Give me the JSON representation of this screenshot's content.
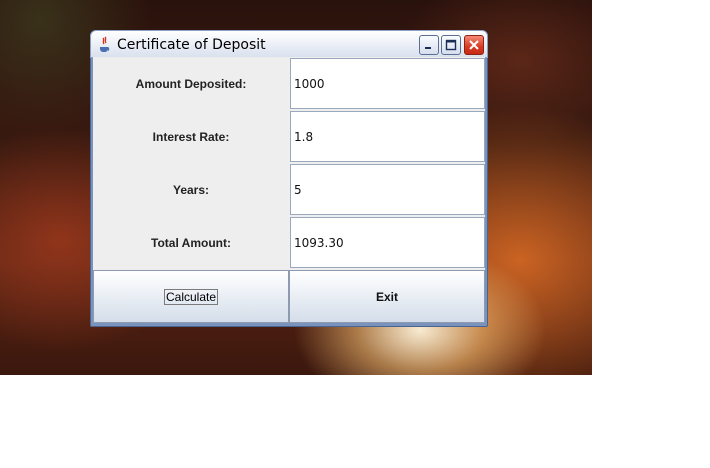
{
  "window": {
    "title": "Certificate of Deposit"
  },
  "form": {
    "rows": [
      {
        "label": "Amount Deposited:",
        "value": "1000"
      },
      {
        "label": "Interest Rate:",
        "value": "1.8"
      },
      {
        "label": "Years:",
        "value": "5"
      },
      {
        "label": "Total Amount:",
        "value": "1093.30"
      }
    ]
  },
  "buttons": {
    "calculate": "Calculate",
    "exit": "Exit"
  },
  "icons": {
    "app": "java-cup-icon",
    "minimize": "minimize-icon",
    "maximize": "maximize-icon",
    "close": "close-icon"
  },
  "colors": {
    "close_button": "#d83a22",
    "titlebar": "#eef2f8"
  }
}
